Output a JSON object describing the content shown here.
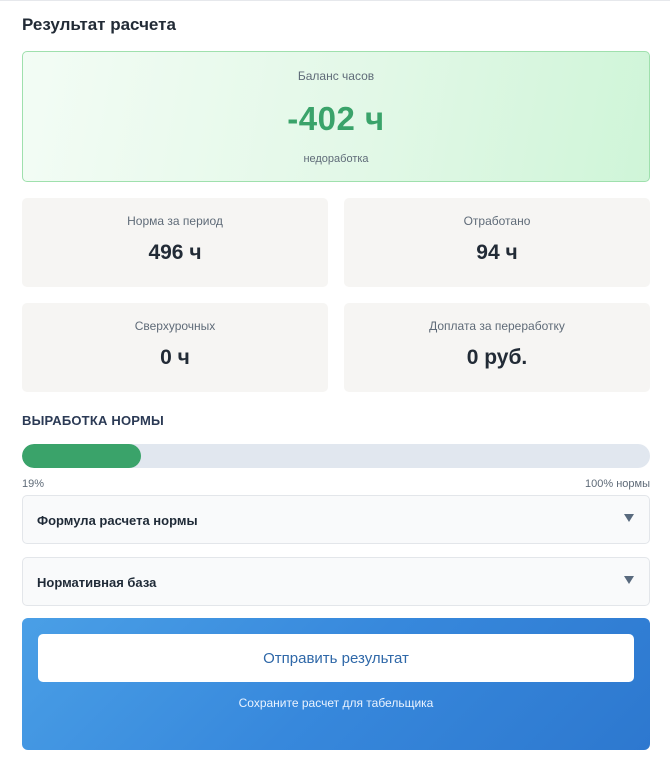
{
  "title": "Результат расчета",
  "balance": {
    "label": "Баланс часов",
    "value": "-402 ч",
    "status": "недоработка",
    "color": "#3aa36a"
  },
  "stats": [
    {
      "label": "Норма за период",
      "value": "496 ч"
    },
    {
      "label": "Отработано",
      "value": "94 ч"
    },
    {
      "label": "Сверхурочных",
      "value": "0 ч"
    },
    {
      "label": "Доплата за переработку",
      "value": "0 руб."
    }
  ],
  "progress": {
    "heading": "ВЫРАБОТКА НОРМЫ",
    "percent": 19,
    "min_label": "19%",
    "max_label": "100% нормы",
    "color": "#3aa36a"
  },
  "accordions": [
    {
      "label": "Формула расчета нормы",
      "icon": "triangle-down-icon"
    },
    {
      "label": "Нормативная база",
      "icon": "triangle-down-icon"
    }
  ],
  "submit": {
    "button_label": "Отправить результат",
    "hint": "Сохраните расчет для табельщика",
    "color": "#3788dc"
  }
}
